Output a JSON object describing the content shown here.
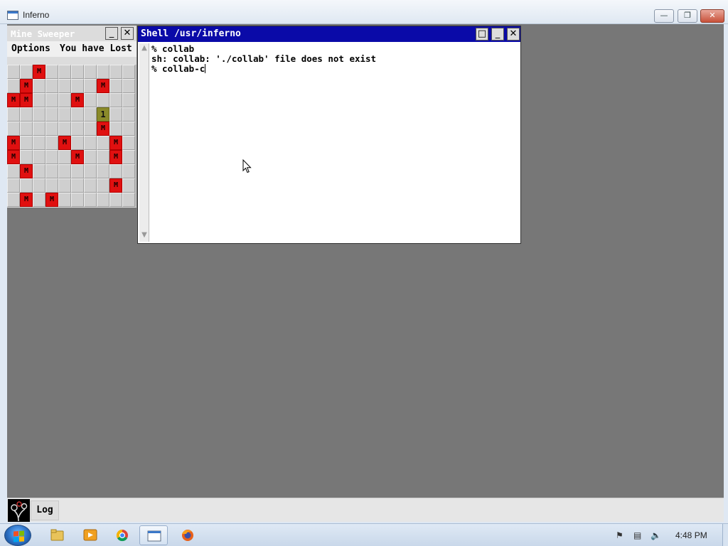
{
  "host_window": {
    "title": "Inferno",
    "buttons": {
      "minimize": "▭",
      "maximize": "▢",
      "close": "✕"
    }
  },
  "minesweeper": {
    "title": "Mine Sweeper",
    "menu_options": "Options",
    "status": "You have Lost",
    "grid": [
      [
        "",
        "",
        "M",
        "",
        "",
        "",
        "",
        "",
        "",
        ""
      ],
      [
        "",
        "M",
        "",
        "",
        "",
        "",
        "",
        "M",
        "",
        ""
      ],
      [
        "M",
        "M",
        "",
        "",
        "",
        "M",
        "",
        "",
        "",
        ""
      ],
      [
        "",
        "",
        "",
        "",
        "",
        "",
        "",
        "1",
        "",
        ""
      ],
      [
        "",
        "",
        "",
        "",
        "",
        "",
        "",
        "M",
        "",
        ""
      ],
      [
        "M",
        "",
        "",
        "",
        "M",
        "",
        "",
        "",
        "M",
        ""
      ],
      [
        "M",
        "",
        "",
        "",
        "",
        "M",
        "",
        "",
        "M",
        ""
      ],
      [
        "",
        "M",
        "",
        "",
        "",
        "",
        "",
        "",
        "",
        ""
      ],
      [
        "",
        "",
        "",
        "",
        "",
        "",
        "",
        "",
        "M",
        ""
      ],
      [
        "",
        "M",
        "",
        "M",
        "",
        "",
        "",
        "",
        "",
        ""
      ]
    ]
  },
  "shell": {
    "title": "Shell /usr/inferno",
    "lines": [
      "% collab",
      "sh: collab: './collab' file does not exist",
      "% collab-c"
    ]
  },
  "inferno_bar": {
    "log_label": "Log"
  },
  "taskbar": {
    "clock": "4:48 PM",
    "apps": [
      "file-explorer",
      "media-player",
      "chrome",
      "inferno-window",
      "firefox"
    ]
  },
  "colors": {
    "desktop_bg": "#777777",
    "shell_title_bg": "#0a0aa8",
    "mine_red": "#e01010",
    "number_cell": "#8a8a2a"
  }
}
